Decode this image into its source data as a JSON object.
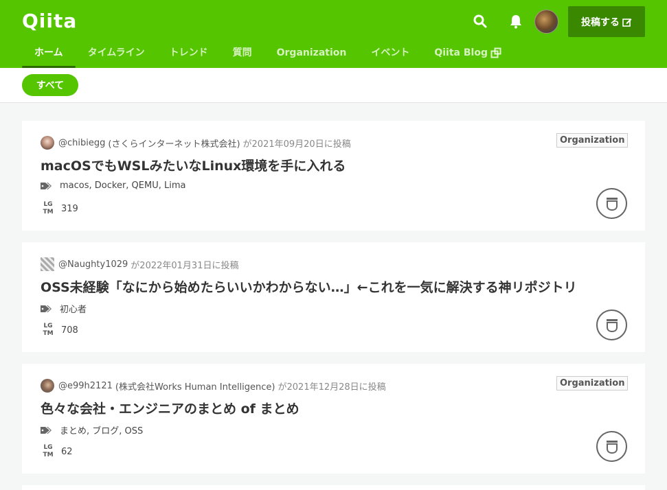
{
  "header": {
    "logo": "Qiita",
    "post_button": "投稿する",
    "icons": {
      "search": "search-icon",
      "bell": "bell-icon",
      "edit": "edit-icon"
    },
    "nav": [
      {
        "label": "ホーム",
        "active": true
      },
      {
        "label": "タイムライン"
      },
      {
        "label": "トレンド"
      },
      {
        "label": "質問"
      },
      {
        "label": "Organization"
      },
      {
        "label": "イベント"
      },
      {
        "label": "Qiita Blog",
        "external": true
      }
    ]
  },
  "filter": {
    "label": "すべて"
  },
  "articles": [
    {
      "user": "@chibiegg",
      "org": "(さくらインターネット株式会社)",
      "date": "が2021年09月20日に投稿",
      "badge": "Organization",
      "title": "macOSでもWSLみたいなLinux環境を手に入れる",
      "tags": "macos, Docker, QEMU, Lima",
      "lgtm": "319"
    },
    {
      "user": "@Naughty1029",
      "org": "",
      "date": "が2022年01月31日に投稿",
      "badge": "",
      "title": "OSS未経験「なにから始めたらいいかわからない…」←これを一気に解決する神リポジトリ",
      "tags": "初心者",
      "lgtm": "708"
    },
    {
      "user": "@e99h2121",
      "org": "(株式会社Works Human Intelligence)",
      "date": "が2021年12月28日に投稿",
      "badge": "Organization",
      "title": "色々な会社・エンジニアのまとめ of まとめ",
      "tags": "まとめ, ブログ, OSS",
      "lgtm": "62"
    }
  ],
  "lgtm_mark": {
    "top": "LG",
    "bottom": "TM"
  },
  "colors": {
    "brand": "#55c500",
    "brand_dark": "#3a8800"
  }
}
